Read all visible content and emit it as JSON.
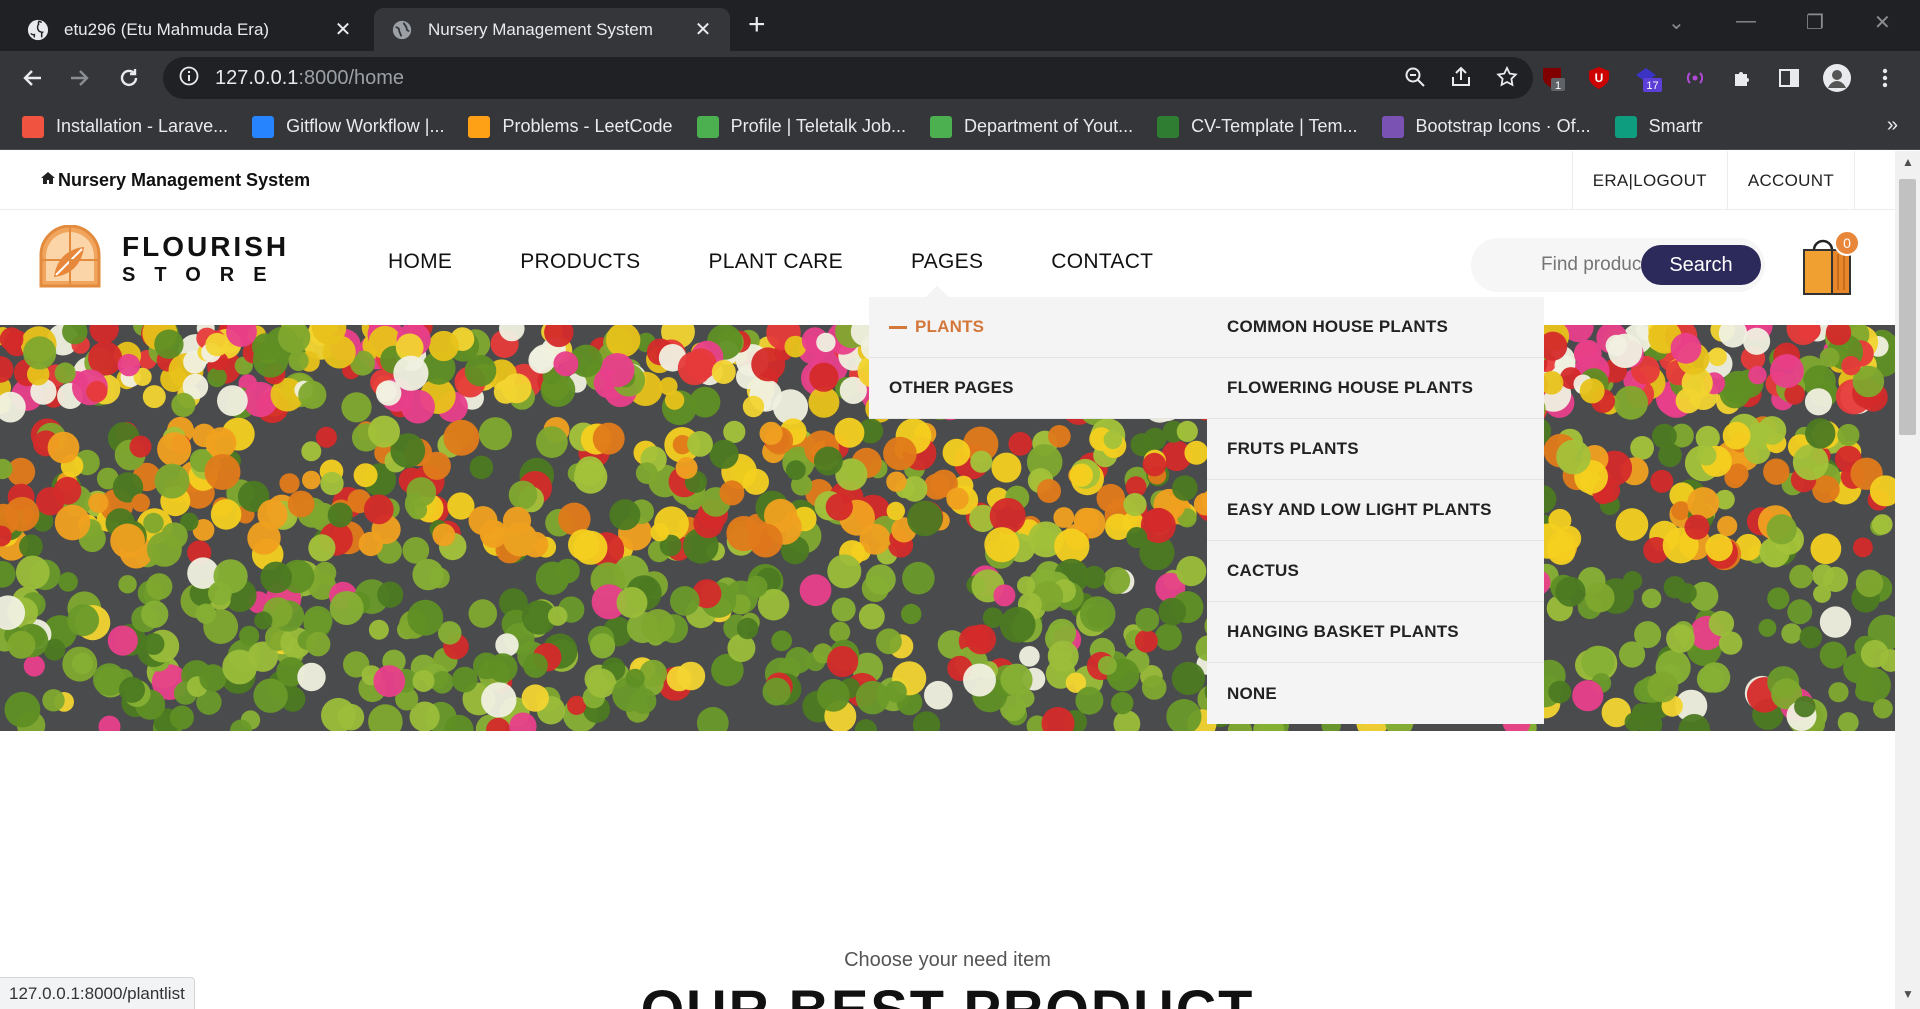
{
  "browser": {
    "tabs": [
      {
        "title": "etu296 (Etu Mahmuda Era)",
        "icon": "github-icon"
      },
      {
        "title": "Nursery Management System",
        "icon": "globe-icon"
      }
    ],
    "url_host": "127.0.0.1",
    "url_path": ":8000/home",
    "extension_badges": {
      "ublock": "1",
      "notifications": "17"
    },
    "bookmarks": [
      {
        "label": "Installation - Larave...",
        "icon": "laravel-icon",
        "color": "#f05340"
      },
      {
        "label": "Gitflow Workflow |...",
        "icon": "atlassian-icon",
        "color": "#2684ff"
      },
      {
        "label": "Problems - LeetCode",
        "icon": "leetcode-icon",
        "color": "#ffa116"
      },
      {
        "label": "Profile | Teletalk Job...",
        "icon": "teletalk-icon",
        "color": "#4caf50"
      },
      {
        "label": "Department of Yout...",
        "icon": "govt-icon",
        "color": "#4caf50"
      },
      {
        "label": "CV-Template | Tem...",
        "icon": "cv-icon",
        "color": "#2e7d32"
      },
      {
        "label": "Bootstrap Icons · Of...",
        "icon": "bootstrap-icon",
        "color": "#7952b3"
      },
      {
        "label": "Smartr",
        "icon": "smartr-icon",
        "color": "#0f9d80"
      }
    ],
    "status_url": "127.0.0.1:8000/plantlist"
  },
  "site": {
    "top_brand": "Nursery Management System",
    "top_links": [
      "ERA|LOGOUT",
      "ACCOUNT"
    ],
    "logo_line1": "FLOURISH",
    "logo_line2": "STORE",
    "nav": [
      "HOME",
      "PRODUCTS",
      "PLANT CARE",
      "PAGES",
      "CONTACT"
    ],
    "search_placeholder": "Find products",
    "search_button": "Search",
    "cart_count": "0",
    "accent_color": "#d4773a",
    "button_color": "#2c2a5a"
  },
  "dropdown": {
    "left": [
      "PLANTS",
      "OTHER PAGES"
    ],
    "right": [
      "COMMON HOUSE PLANTS",
      "FLOWERING HOUSE PLANTS",
      "FRUTS PLANTS",
      "EASY AND LOW LIGHT PLANTS",
      "CACTUS",
      "HANGING BASKET PLANTS",
      "NONE"
    ]
  },
  "section": {
    "subtitle": "Choose your need item",
    "title": "OUR BEST PRODUCT"
  }
}
